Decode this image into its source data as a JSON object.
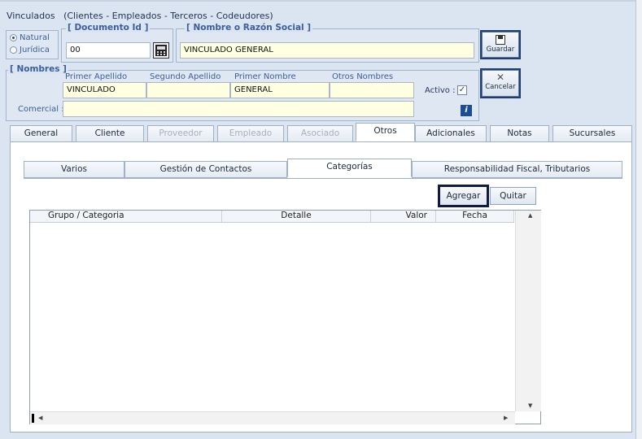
{
  "window": {
    "title": "Vinculados",
    "subtitle": "(Clientes - Empleados - Terceros - Codeudores)"
  },
  "person_type": {
    "options": [
      {
        "label": "Natural",
        "selected": true
      },
      {
        "label": "Jurídica",
        "selected": false
      }
    ]
  },
  "documento": {
    "legend": "[ Documento Id ]",
    "value": "00"
  },
  "razon_social": {
    "legend": "[ Nombre o Razón Social ]",
    "value": "VINCULADO GENERAL"
  },
  "nombres": {
    "legend": "[ Nombres ]",
    "primer_apellido_label": "Primer Apellido",
    "segundo_apellido_label": "Segundo Apellido",
    "primer_nombre_label": "Primer Nombre",
    "otros_nombres_label": "Otros Nombres",
    "primer_apellido": "VINCULADO",
    "segundo_apellido": "",
    "primer_nombre": "GENERAL",
    "otros_nombres": "",
    "activo_label": "Activo :",
    "activo_checked": true,
    "comercial_label": "Comercial :",
    "comercial": ""
  },
  "actions": {
    "save_label": "Guardar",
    "cancel_label": "Cancelar"
  },
  "main_tabs": [
    {
      "label": "General",
      "state": "normal"
    },
    {
      "label": "Cliente",
      "state": "normal"
    },
    {
      "label": "Proveedor",
      "state": "disabled"
    },
    {
      "label": "Empleado",
      "state": "disabled"
    },
    {
      "label": "Asociado",
      "state": "disabled"
    },
    {
      "label": "Otros",
      "state": "active"
    },
    {
      "label": "Adicionales",
      "state": "normal"
    },
    {
      "label": "Notas",
      "state": "normal"
    },
    {
      "label": "Sucursales",
      "state": "normal"
    }
  ],
  "sub_tabs": [
    {
      "label": "Varios",
      "state": "normal"
    },
    {
      "label": "Gestión de Contactos",
      "state": "normal"
    },
    {
      "label": "Categorías",
      "state": "active"
    },
    {
      "label": "Responsabilidad Fiscal, Tributarios",
      "state": "normal"
    }
  ],
  "categorias": {
    "add_label": "Agregar",
    "remove_label": "Quitar",
    "columns": [
      "Grupo / Categoria",
      "Detalle",
      "Valor",
      "Fecha"
    ],
    "rows": []
  },
  "colors": {
    "window_bg": "#dbe5f1",
    "legend_text": "#3a5f9a",
    "field_bg": "#ffffe1",
    "focus_border": "#111a44"
  }
}
